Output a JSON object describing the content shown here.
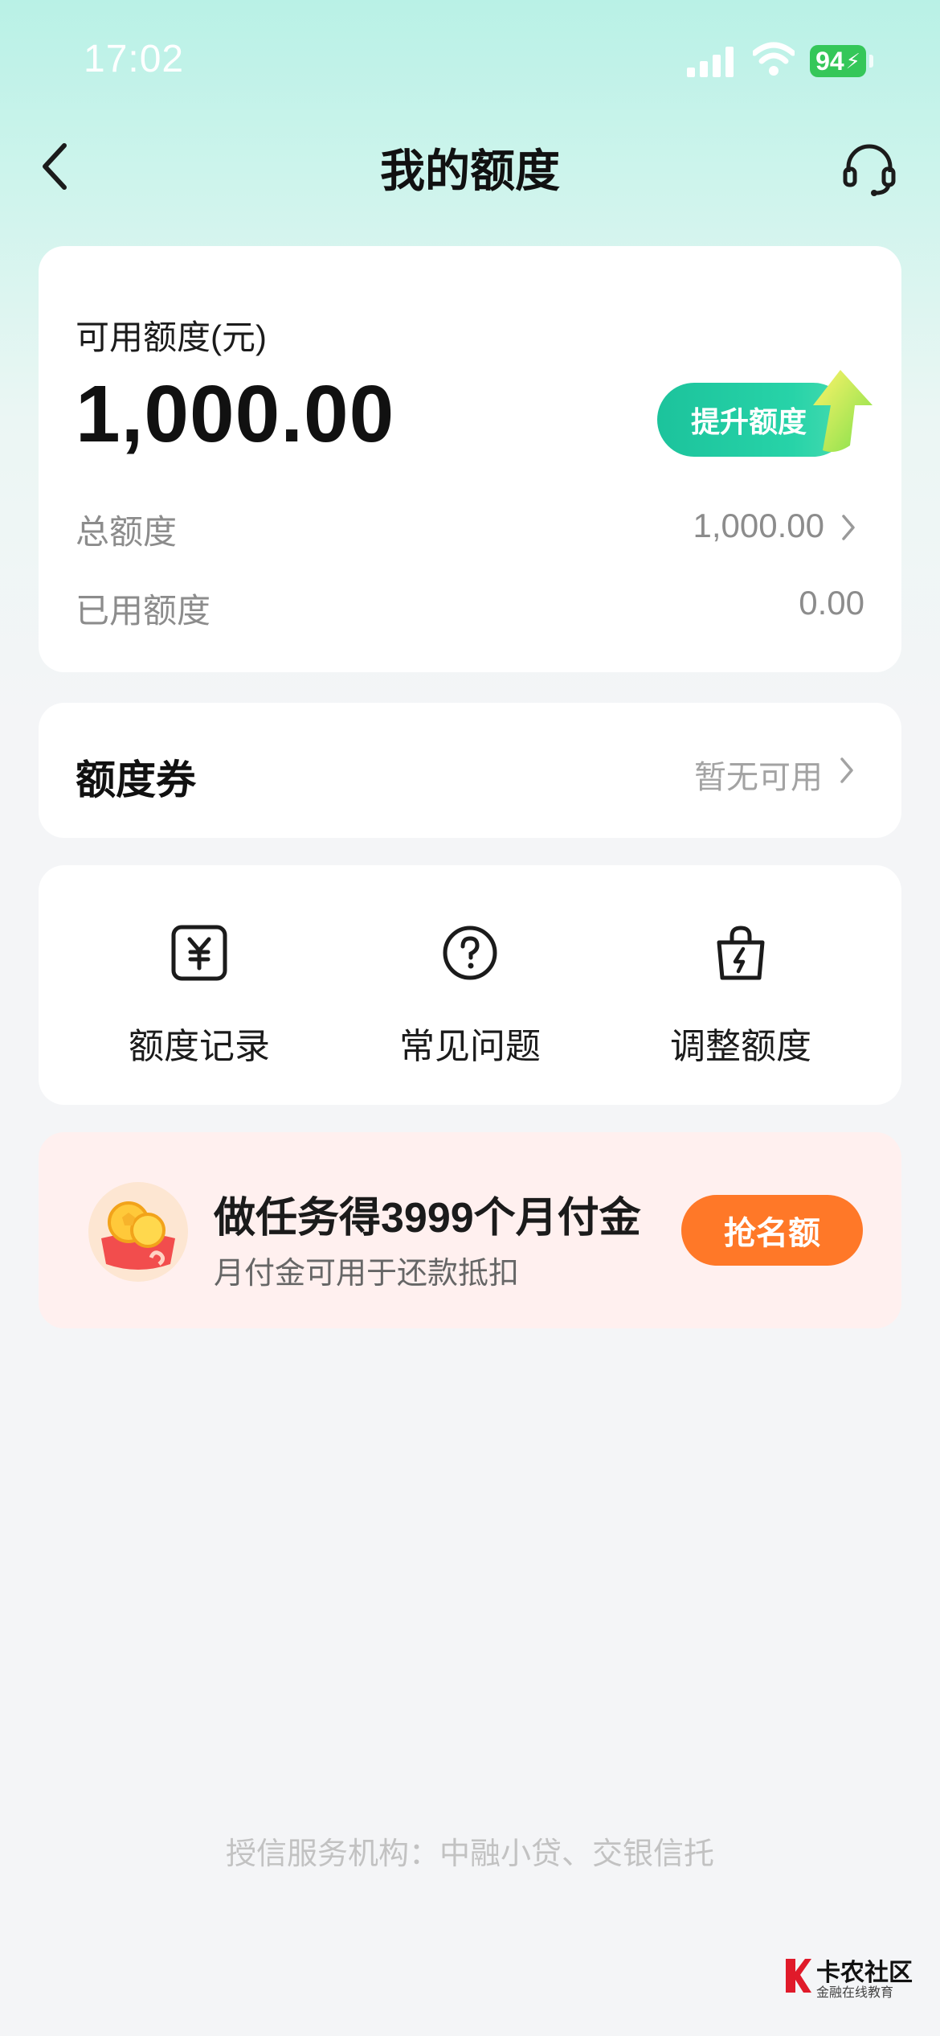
{
  "status_bar": {
    "time": "17:02",
    "battery": "94"
  },
  "nav": {
    "title": "我的额度",
    "back_icon": "chevron-left-icon",
    "service_icon": "headset-icon"
  },
  "quota": {
    "available_label": "可用额度(元)",
    "available_amount": "1,000.00",
    "raise_button": "提升额度",
    "total_label": "总额度",
    "total_value": "1,000.00",
    "used_label": "已用额度",
    "used_value": "0.00"
  },
  "coupon": {
    "title": "额度券",
    "status": "暂无可用"
  },
  "shortcuts": [
    {
      "label": "额度记录",
      "icon": "yuan-record-icon"
    },
    {
      "label": "常见问题",
      "icon": "question-icon"
    },
    {
      "label": "调整额度",
      "icon": "bag-lightning-icon"
    }
  ],
  "promo": {
    "title": "做任务得3999个月付金",
    "subtitle": "月付金可用于还款抵扣",
    "button": "抢名额",
    "icon": "coin-pouch-icon"
  },
  "footer": {
    "note": "授信服务机构：中融小贷、交银信托"
  },
  "watermark": {
    "name": "卡农社区",
    "tagline": "金融在线教育"
  },
  "colors": {
    "accent_green": "#1cc39c",
    "promo_orange": "#ff7828",
    "promo_bg": "#fff0ef"
  }
}
